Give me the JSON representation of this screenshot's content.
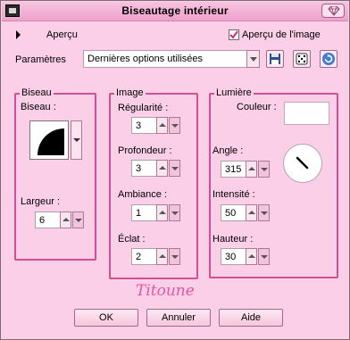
{
  "window": {
    "title": "Biseautage intérieur"
  },
  "preview": {
    "label": "Aperçu",
    "checkbox_label": "Aperçu de l'image",
    "checked": true
  },
  "params": {
    "label": "Paramètres",
    "value": "Dernières options utilisées"
  },
  "groups": {
    "biseau": {
      "title": "Biseau",
      "shape_label": "Biseau :",
      "largeur_label": "Largeur :",
      "largeur_value": "6"
    },
    "image": {
      "title": "Image",
      "regularite_label": "Régularité :",
      "regularite_value": "3",
      "profondeur_label": "Profondeur :",
      "profondeur_value": "3",
      "ambiance_label": "Ambiance :",
      "ambiance_value": "1",
      "eclat_label": "Éclat :",
      "eclat_value": "2"
    },
    "lumiere": {
      "title": "Lumière",
      "couleur_label": "Couleur :",
      "couleur_value": "#ffffff",
      "angle_label": "Angle :",
      "angle_value": "315",
      "intensite_label": "Intensité :",
      "intensite_value": "50",
      "hauteur_label": "Hauteur :",
      "hauteur_value": "30"
    }
  },
  "signature": "Titoune",
  "buttons": {
    "ok": "OK",
    "cancel": "Annuler",
    "help": "Aide"
  },
  "colors": {
    "window_bg": "#fccfe8",
    "group_border": "#d24e95",
    "signature": "#e256a3"
  }
}
